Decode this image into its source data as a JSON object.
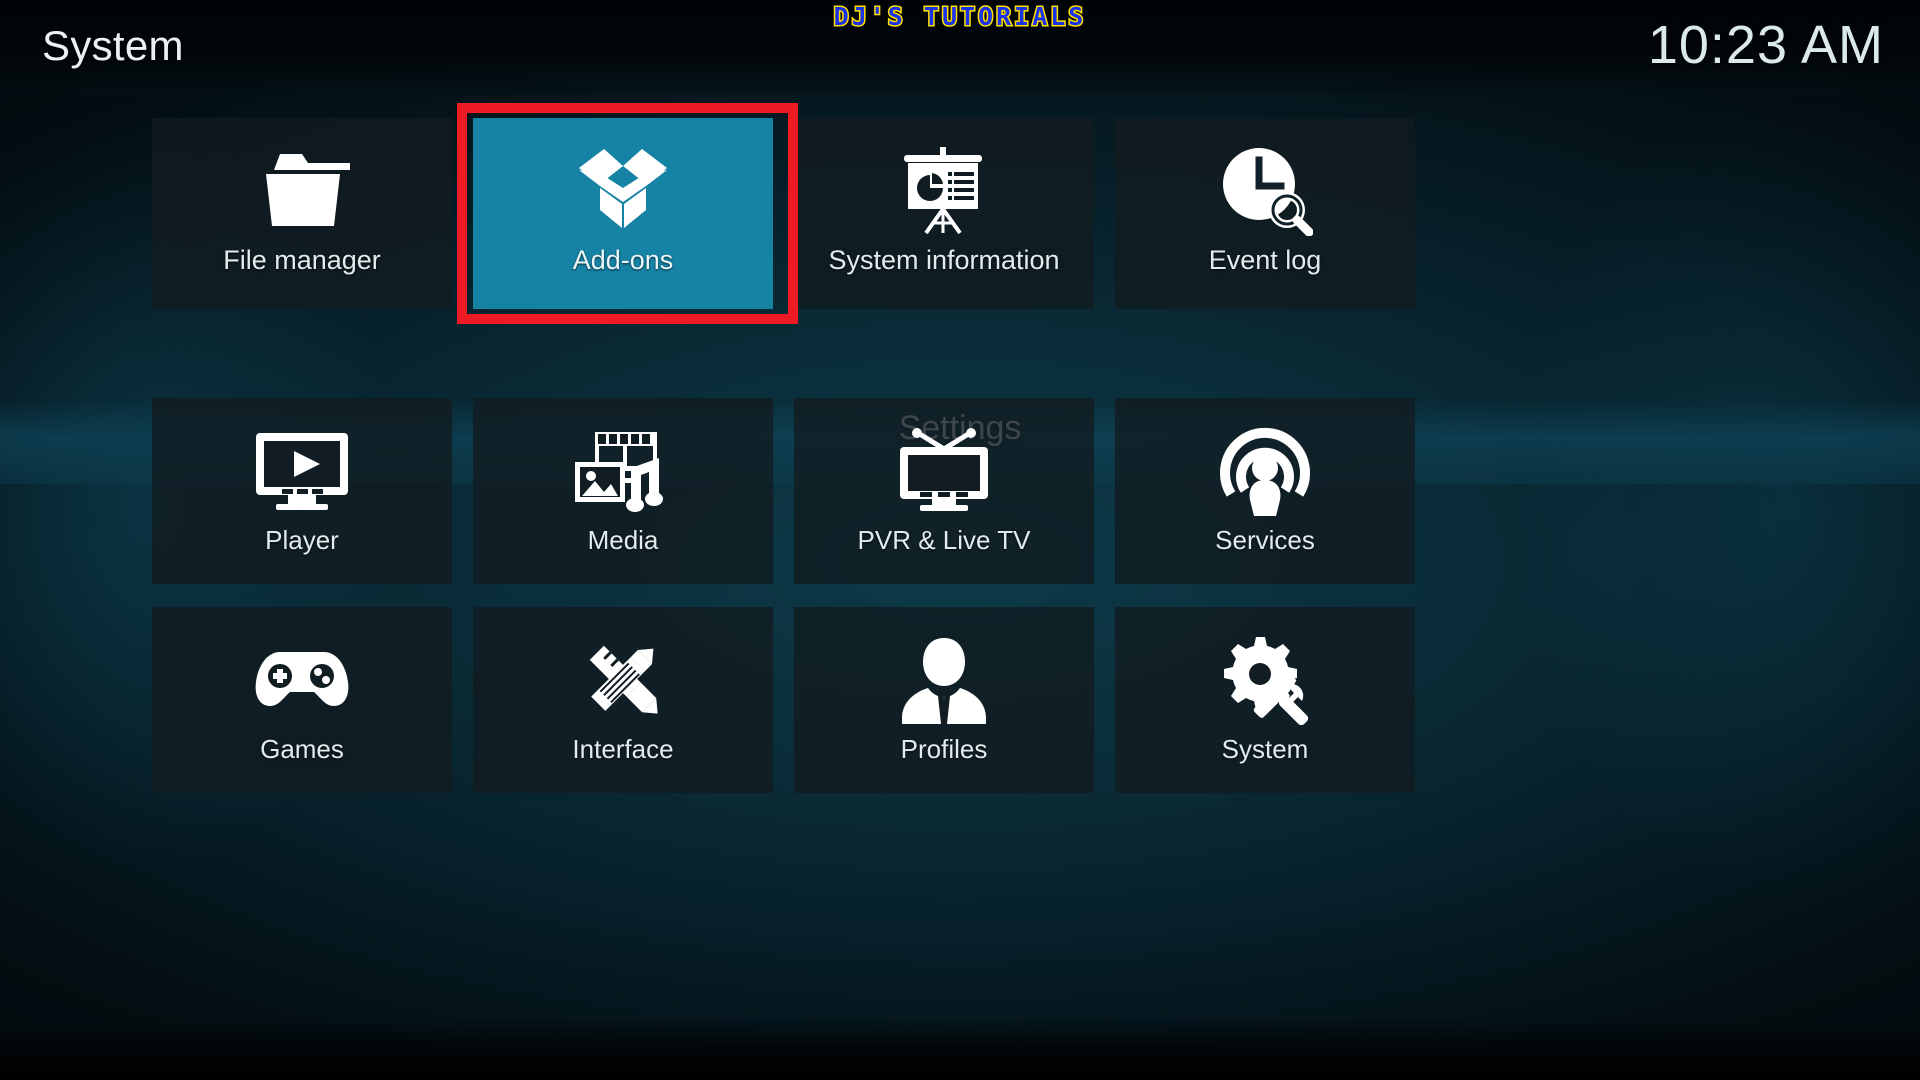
{
  "window": {
    "title": "System",
    "clock": "10:23 AM",
    "watermark": "DJ'S TUTORIALS"
  },
  "colors": {
    "selected_tile": "#1683a5",
    "focus_ring": "#ed1c24",
    "tile_background": "#111c20",
    "text": "#e2ecef",
    "watermark_fill": "#1a32e8",
    "watermark_stroke": "#ffe000"
  },
  "sections": {
    "top_row": {
      "items": [
        {
          "label": "File manager",
          "icon": "folder-icon",
          "selected": false
        },
        {
          "label": "Add-ons",
          "icon": "open-box-icon",
          "selected": true
        },
        {
          "label": "System information",
          "icon": "presentation-icon",
          "selected": false
        },
        {
          "label": "Event log",
          "icon": "clock-search-icon",
          "selected": false
        }
      ]
    },
    "settings": {
      "heading": "Settings",
      "rows": [
        {
          "items": [
            {
              "label": "Player",
              "icon": "monitor-play-icon",
              "selected": false
            },
            {
              "label": "Media",
              "icon": "media-mix-icon",
              "selected": false
            },
            {
              "label": "PVR & Live TV",
              "icon": "tv-antenna-icon",
              "selected": false
            },
            {
              "label": "Services",
              "icon": "broadcast-user-icon",
              "selected": false
            }
          ]
        },
        {
          "items": [
            {
              "label": "Games",
              "icon": "gamepad-icon",
              "selected": false
            },
            {
              "label": "Interface",
              "icon": "pencil-ruler-icon",
              "selected": false
            },
            {
              "label": "Profiles",
              "icon": "person-bust-icon",
              "selected": false
            },
            {
              "label": "System",
              "icon": "gear-wrench-icon",
              "selected": false
            }
          ]
        }
      ]
    }
  }
}
